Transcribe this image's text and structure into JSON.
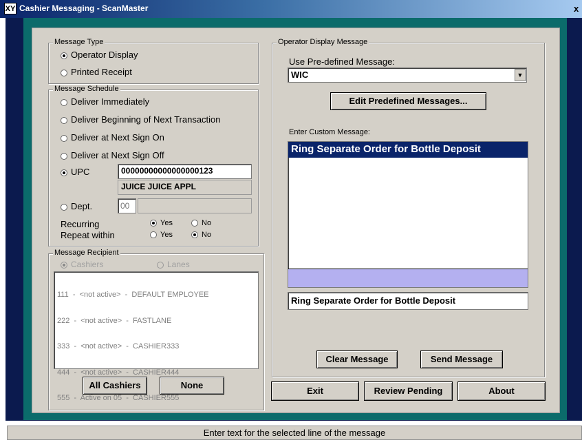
{
  "window": {
    "title": "Cashier Messaging - ScanMaster",
    "app_icon": "XY",
    "close_glyph": "x"
  },
  "message_type": {
    "title": "Message Type",
    "options": [
      "Operator Display",
      "Printed Receipt"
    ],
    "selected": 0
  },
  "schedule": {
    "title": "Message Schedule",
    "options": [
      "Deliver Immediately",
      "Deliver Beginning of Next Transaction",
      "Deliver at Next Sign On",
      "Deliver at Next Sign Off",
      "UPC",
      "Dept."
    ],
    "selected": 4,
    "upc_value": "00000000000000000123",
    "upc_desc": "JUICE JUICE APPL",
    "dept_value": "00",
    "dept_desc": "",
    "recurring_label": "Recurring",
    "repeat_label": "Repeat within",
    "yes": "Yes",
    "no": "No",
    "recurring_selected": "Yes",
    "repeat_selected": "No"
  },
  "recipient": {
    "title": "Message Recipient",
    "cashiers_label": "Cashiers",
    "lanes_label": "Lanes",
    "list": [
      "111  -  <not active>  -  DEFAULT EMPLOYEE",
      "222  -  <not active>  -  FASTLANE",
      "333  -  <not active>  -  CASHIER333",
      "444  -  <not active>  -  CASHIER444",
      "555  -  Active on 05  -  CASHIER555"
    ],
    "all_button": "All Cashiers",
    "none_button": "None"
  },
  "display": {
    "title": "Operator Display Message",
    "predefined_label": "Use Pre-defined Message:",
    "predefined_value": "WIC",
    "edit_button": "Edit Predefined Messages...",
    "custom_label": "Enter Custom Message:",
    "lines": [
      "Ring Separate Order for Bottle Deposit"
    ],
    "edit_value": "Ring Separate Order for Bottle Deposit",
    "clear_button": "Clear Message",
    "send_button": "Send Message"
  },
  "bottom_buttons": {
    "exit": "Exit",
    "review": "Review Pending",
    "about": "About"
  },
  "status": "Enter text for the selected line of the message",
  "colors": {
    "title_start": "#0a246a",
    "selection": "#0a246a",
    "highlight": "#b4b0f0",
    "teal": "#0b6b6b"
  }
}
